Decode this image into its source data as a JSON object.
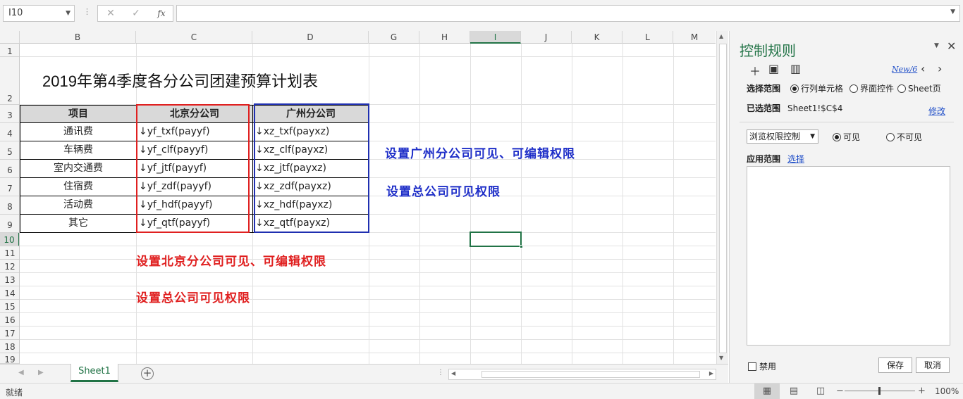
{
  "formula_bar": {
    "name_box": "I10",
    "cancel_icon": "✕",
    "enter_icon": "✓",
    "fx_label": "fx",
    "formula": ""
  },
  "columns": [
    "B",
    "C",
    "D",
    "G",
    "H",
    "I",
    "J",
    "K",
    "L",
    "M"
  ],
  "rows": [
    "1",
    "2",
    "3",
    "4",
    "5",
    "6",
    "7",
    "8",
    "9",
    "10",
    "11",
    "12",
    "13",
    "14",
    "15",
    "16",
    "17",
    "18",
    "19"
  ],
  "sheet": {
    "title": "2019年第4季度各分公司团建预算计划表",
    "headers": [
      "项目",
      "北京分公司",
      "广州分公司"
    ],
    "items": [
      "通讯费",
      "车辆费",
      "室内交通费",
      "住宿费",
      "活动费",
      "其它"
    ],
    "beijing": [
      "↓yf_txf(payyf)",
      "↓yf_clf(payyf)",
      "↓yf_jtf(payyf)",
      "↓yf_zdf(payyf)",
      "↓yf_hdf(payyf)",
      "↓yf_qtf(payyf)"
    ],
    "guangzhou": [
      "↓xz_txf(payxz)",
      "↓xz_clf(payxz)",
      "↓xz_jtf(payxz)",
      "↓xz_zdf(payxz)",
      "↓xz_hdf(payxz)",
      "↓xz_qtf(payxz)"
    ]
  },
  "annotations": {
    "blue_1": "设置广州分公司可见、可编辑权限",
    "blue_2": "设置总公司可见权限",
    "red_1": "设置北京分公司可见、可编辑权限",
    "red_2": "设置总公司可见权限"
  },
  "tabs": {
    "sheet_name": "Sheet1",
    "add": "+"
  },
  "status": {
    "text": "就绪",
    "zoom": "100%",
    "minus": "−",
    "plus": "+"
  },
  "pane": {
    "title": "控制规则",
    "close": "✕",
    "rule_count": "New/6",
    "select_range_label": "选择范围",
    "range_options": [
      "行列单元格",
      "界面控件",
      "Sheet页"
    ],
    "selected_label": "已选范围",
    "selected_value": "Sheet1!$C$4",
    "modify_link": "修改",
    "mode_value": "浏览权限控制",
    "visibility_options": [
      "可见",
      "不可见"
    ],
    "apply_label": "应用范围",
    "select_link": "选择",
    "disable_label": "禁用",
    "save_button": "保存",
    "cancel_button": "取消"
  },
  "colors": {
    "accent": "#217346",
    "red": "#e02020",
    "blue": "#1f2fc8",
    "header_fill": "#d9d9d9"
  }
}
